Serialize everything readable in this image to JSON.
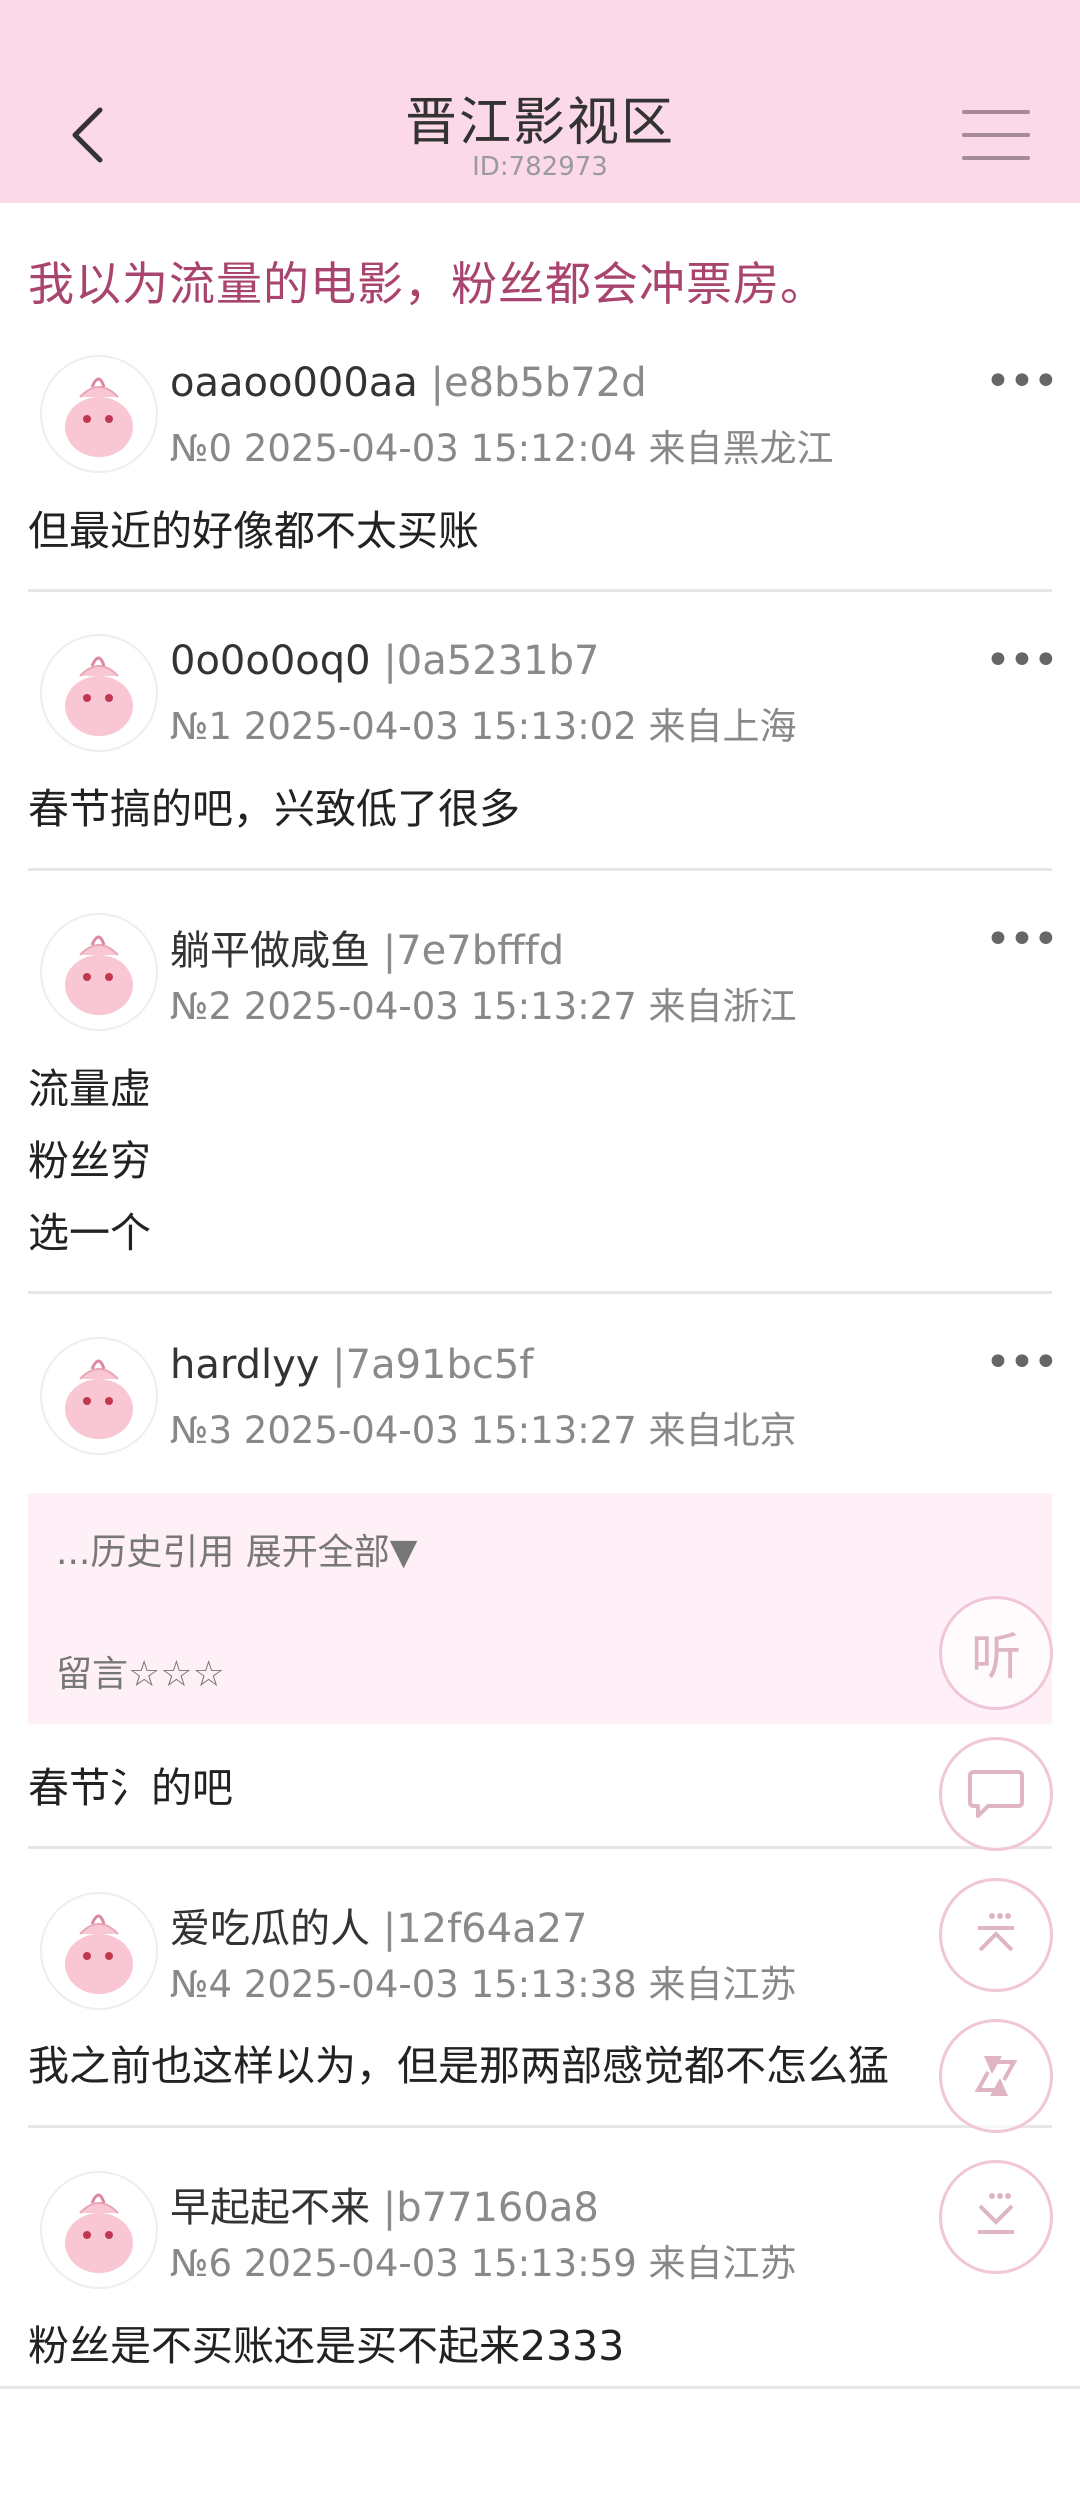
{
  "header": {
    "title": "晋江影视区",
    "subtitle": "ID:782973"
  },
  "topic": "我以为流量的电影，粉丝都会冲票房。",
  "posts": [
    {
      "name": "oaaoo000aa",
      "uid": "|e8b5b72d",
      "meta": "№0 2025-04-03 15:12:04 来自黑龙江",
      "lines": [
        "但最近的好像都不太买账"
      ]
    },
    {
      "name": "0o0o0oq0",
      "uid": "|0a5231b7",
      "meta": "№1 2025-04-03 15:13:02 来自上海",
      "lines": [
        "春节搞的吧，兴致低了很多"
      ]
    },
    {
      "name": "躺平做咸鱼",
      "uid": "|7e7bfffd",
      "meta": "№2 2025-04-03 15:13:27 来自浙江",
      "lines": [
        "流量虚",
        "粉丝穷",
        "选一个"
      ]
    },
    {
      "name": "hardlyy",
      "uid": "|7a91bc5f",
      "meta": "№3 2025-04-03 15:13:27 来自北京",
      "lines": [
        "春节氵的吧"
      ]
    },
    {
      "name": "爱吃瓜的人",
      "uid": "|12f64a27",
      "meta": "№4 2025-04-03 15:13:38 来自江苏",
      "lines": [
        "我之前也这样以为，但是那两部感觉都不怎么猛"
      ]
    },
    {
      "name": "早起起不来",
      "uid": "|b77160a8",
      "meta": "№6 2025-04-03 15:13:59 来自江苏",
      "lines": [
        "粉丝是不买账还是买不起来2333"
      ]
    }
  ],
  "quote": {
    "expand_text": "...历史引用 展开全部▼",
    "stars_text": "留言☆☆☆"
  },
  "fab": {
    "listen_label": "听"
  },
  "icons": {
    "back": "chevron-left-icon",
    "menu": "hamburger-menu-icon",
    "more": "more-dots-icon",
    "avatar": "pink-creature-avatar",
    "comment": "speech-bubble-icon",
    "top": "scroll-top-icon",
    "refresh": "refresh-arrows-icon",
    "bottom": "scroll-bottom-icon"
  },
  "colors": {
    "header_bg": "#fcd9e8",
    "topic_text": "#a8446e",
    "quote_bg": "#fff0f7",
    "fab_border": "#f0c6d8"
  }
}
